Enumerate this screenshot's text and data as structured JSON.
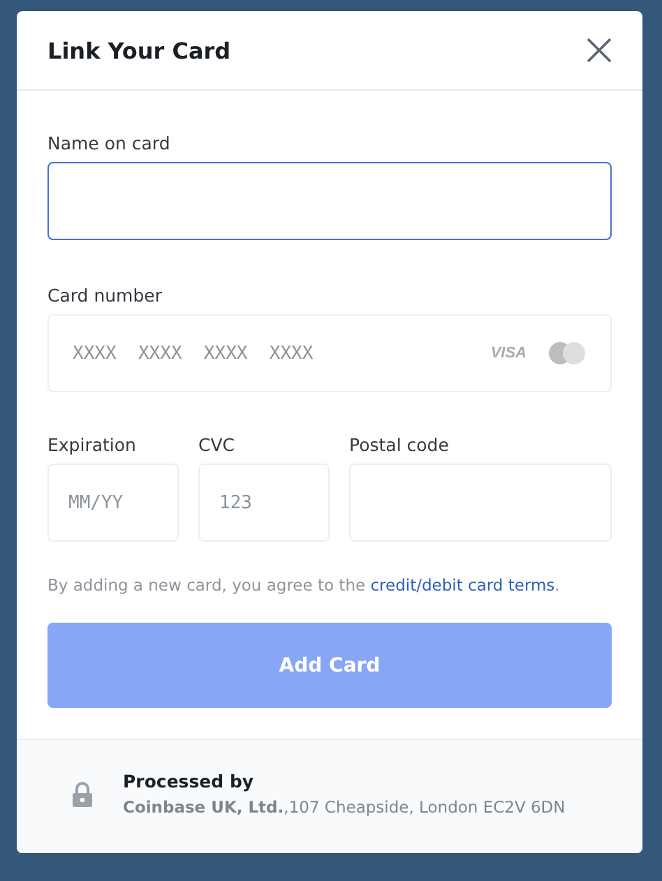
{
  "dialog": {
    "title": "Link Your Card"
  },
  "fields": [
    {
      "label": "Name on card",
      "focused": true
    },
    {
      "label": "Card number",
      "placeholder": "XXXX  XXXX  XXXX  XXXX",
      "focused": false,
      "brand": "VISA"
    }
  ],
  "row_fields": [
    {
      "label": "Expiration",
      "placeholder": "MM/YY",
      "focused": false
    },
    {
      "label": "CVC",
      "placeholder": "123",
      "focused": false
    },
    {
      "label": "Postal code",
      "focused": false
    }
  ],
  "terms": {
    "text": "By adding a new card, you agree to the",
    "link": "credit/debit card terms",
    "after": "."
  },
  "submit": {
    "label": "Add Card",
    "disabled": true
  },
  "footer": {
    "title": "Processed by",
    "address": "**Coinbase UK, Ltd.**,107 Cheapside, London EC2V 6DN"
  }
}
